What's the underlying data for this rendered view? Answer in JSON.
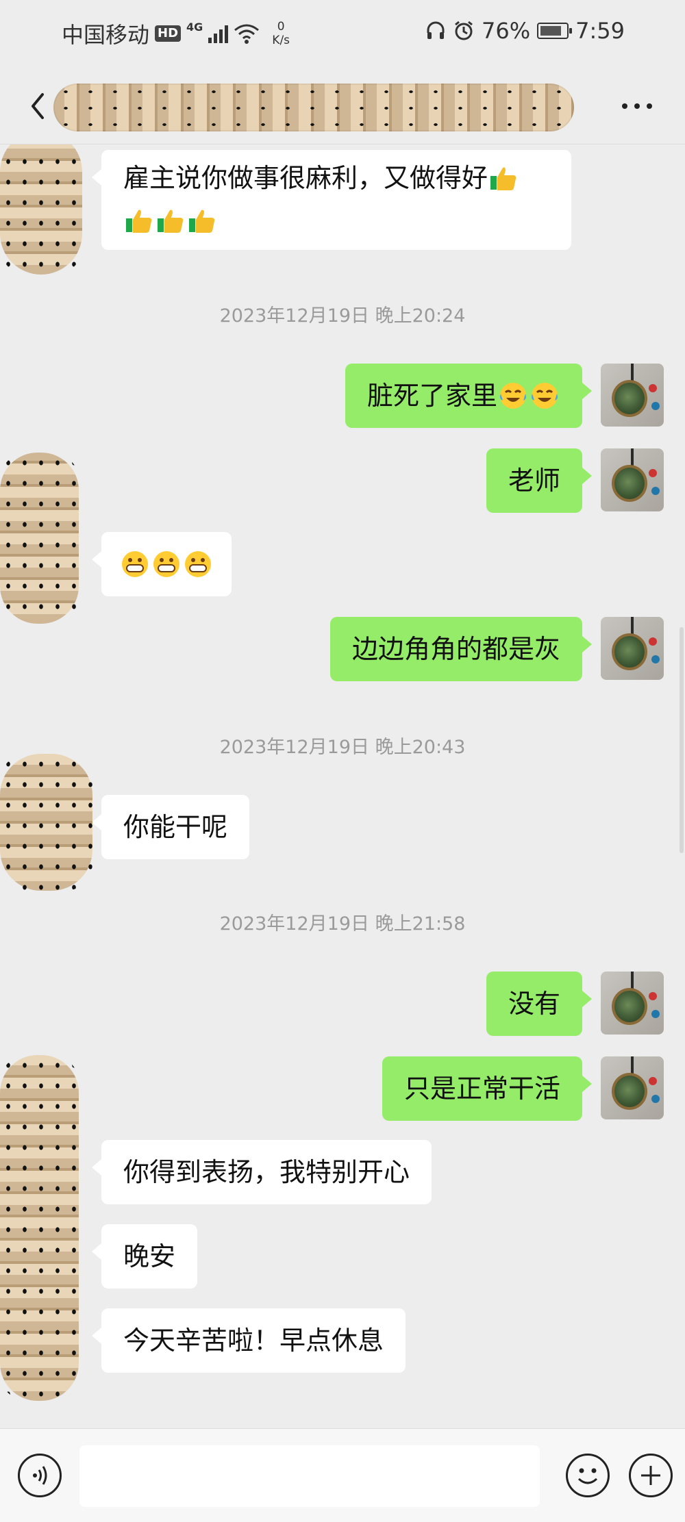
{
  "status_bar": {
    "carrier": "中国移动",
    "hd_badge": "HD",
    "network": "4G",
    "speed_value": "0",
    "speed_unit": "K/s",
    "battery": "76%",
    "time": "7:59"
  },
  "nav": {
    "back_icon": "chevron-left-icon",
    "more_icon": "more-icon"
  },
  "messages": [
    {
      "side": "in",
      "text": "雇主说你做事很麻利，又做得好",
      "emoji_inline": "thumbs-up",
      "emoji_line2": [
        "thumbs-up",
        "thumbs-up",
        "thumbs-up"
      ]
    },
    {
      "type": "timestamp",
      "text": "2023年12月19日 晚上20:24"
    },
    {
      "side": "out",
      "text": "脏死了家里",
      "emoji": [
        "face-with-tears-of-joy",
        "face-with-tears-of-joy"
      ]
    },
    {
      "side": "out",
      "text": "老师"
    },
    {
      "side": "in",
      "emoji": [
        "grinning-face",
        "grinning-face",
        "grinning-face"
      ]
    },
    {
      "side": "out",
      "text": "边边角角的都是灰"
    },
    {
      "type": "timestamp",
      "text": "2023年12月19日 晚上20:43"
    },
    {
      "side": "in",
      "text": "你能干呢"
    },
    {
      "type": "timestamp",
      "text": "2023年12月19日 晚上21:58"
    },
    {
      "side": "out",
      "text": "没有"
    },
    {
      "side": "out",
      "text": "只是正常干活"
    },
    {
      "side": "in",
      "text": "你得到表扬，我特别开心"
    },
    {
      "side": "in",
      "text": "晚安"
    },
    {
      "side": "in",
      "text": "今天辛苦啦！早点休息"
    }
  ],
  "input_bar": {
    "voice_icon": "voice-icon",
    "emoji_icon": "smiley-icon",
    "plus_icon": "plus-icon",
    "placeholder": ""
  },
  "colors": {
    "background": "#ededed",
    "bubble_out": "#95ec69",
    "bubble_in": "#ffffff",
    "timestamp_text": "#9a9a9a"
  }
}
